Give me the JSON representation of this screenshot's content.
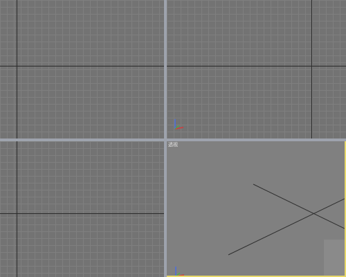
{
  "viewports": {
    "bottom_right": {
      "label": "透视"
    }
  },
  "colors": {
    "active_border": "#e7d86a",
    "splitter": "#9ea3ad",
    "grid_minor": "#7f7f7f",
    "grid_major": "#2a2a2a",
    "axis_x": "#d23c3c",
    "axis_y": "#3cbf3c",
    "axis_z": "#4a6ee0"
  },
  "icons": [
    "axis-tripod-icon"
  ]
}
